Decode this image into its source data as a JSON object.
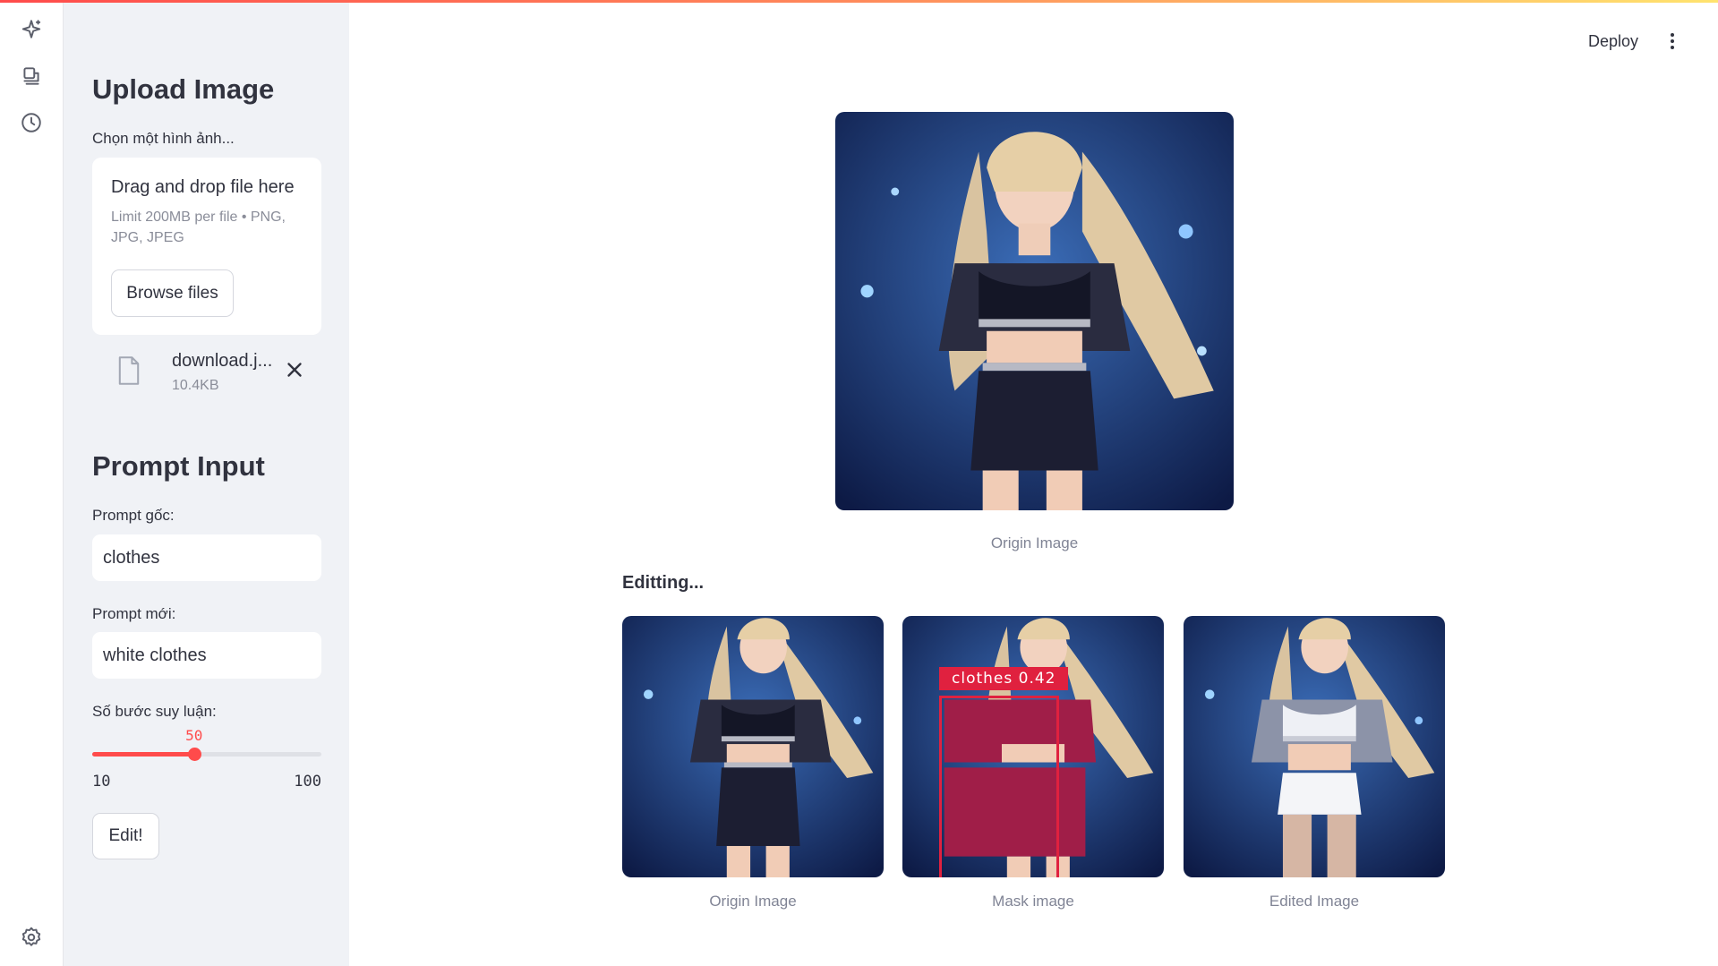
{
  "rail": {
    "icons": [
      "sparkle-icon",
      "robot-icon",
      "clock-history-icon",
      "settings-icon"
    ]
  },
  "sidebar": {
    "upload_title": "Upload Image",
    "upload_label": "Chọn một hình ảnh...",
    "dropzone_title": "Drag and drop file here",
    "dropzone_limit": "Limit 200MB per file • PNG, JPG, JPEG",
    "browse_label": "Browse files",
    "file": {
      "name": "download.jpg",
      "display_name": "download.j...",
      "size": "10.4KB"
    },
    "prompt_title": "Prompt Input",
    "prompt_original_label": "Prompt gốc:",
    "prompt_original_value": "clothes",
    "prompt_new_label": "Prompt mới:",
    "prompt_new_value": "white clothes",
    "steps_label": "Số bước suy luận:",
    "steps": {
      "value": 50,
      "min": 10,
      "max": 100,
      "value_text": "50",
      "min_text": "10",
      "max_text": "100"
    },
    "edit_label": "Edit!"
  },
  "header": {
    "deploy_label": "Deploy"
  },
  "main": {
    "top_caption": "Origin Image",
    "status_text": "Editting...",
    "results": [
      {
        "caption": "Origin Image"
      },
      {
        "caption": "Mask image",
        "detection_label": "clothes 0.42"
      },
      {
        "caption": "Edited Image"
      }
    ]
  },
  "colors": {
    "accent": "#ff4b4b",
    "mask": "#e0213f",
    "sidebar_bg": "#f0f2f6"
  }
}
